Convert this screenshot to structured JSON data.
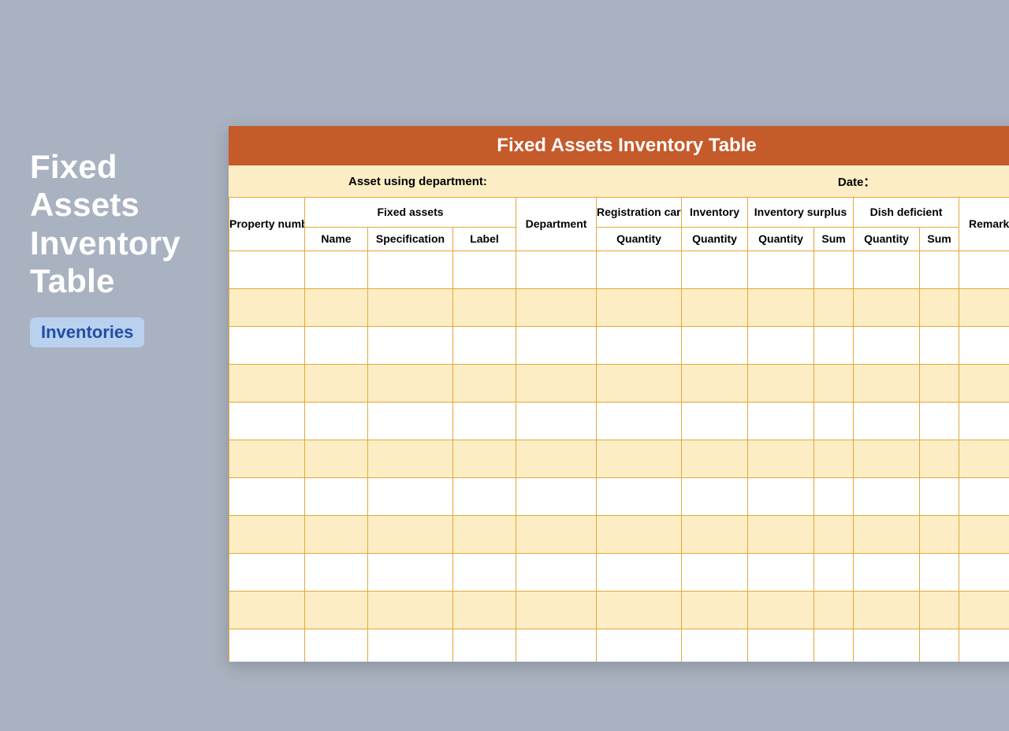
{
  "sidebar": {
    "title": "Fixed Assets Inventory Table",
    "tag": "Inventories"
  },
  "sheet": {
    "title": "Fixed Assets Inventory Table",
    "asset_label": "Asset using department:",
    "date_label": "Date："
  },
  "headers": {
    "property_number": "Property number",
    "fixed_assets": "Fixed assets",
    "name": "Name",
    "specification": "Specification",
    "label": "Label",
    "department": "Department",
    "registration_card": "Registration card",
    "inventory": "Inventory",
    "inventory_surplus": "Inventory surplus",
    "dish_deficient": "Dish deficient",
    "remarks": "Remarks",
    "quantity": "Quantity",
    "sum": "Sum"
  },
  "row_count": 11
}
